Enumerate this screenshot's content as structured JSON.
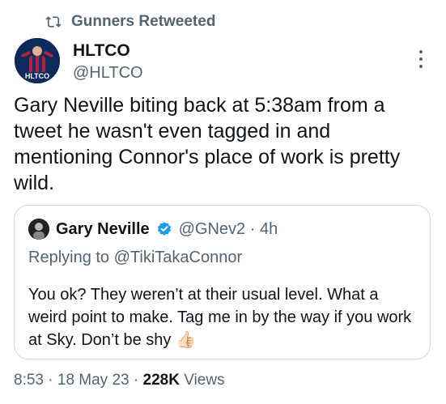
{
  "retweet": {
    "label": "Gunners Retweeted",
    "icon": "retweet-icon"
  },
  "author": {
    "name": "HLTCO",
    "handle": "@HLTCO",
    "avatar_text": "HLTCO"
  },
  "tweet": {
    "text": "Gary Neville biting back at 5:38am from a tweet he wasn't even tagged in and mentioning Connor's place of work is pretty wild."
  },
  "quote": {
    "name": "Gary Neville",
    "handle": "@GNev2",
    "separator": "·",
    "time": "4h",
    "replying_prefix": "Replying to ",
    "replying_to": "@TikiTakaConnor",
    "text": "You ok? They weren’t at their usual level. What a weird point to make. Tag me in by the way if you work at Sky. Don’t be shy",
    "emoji": "👍🏻"
  },
  "footer": {
    "time": "8:53",
    "sep1": "·",
    "date": "18 May 23",
    "sep2": "·",
    "views_count": "228K",
    "views_label": "Views"
  },
  "colors": {
    "text": "#0f1419",
    "secondary": "#536471",
    "border": "#cfd9de",
    "verified": "#1d9bf0"
  }
}
